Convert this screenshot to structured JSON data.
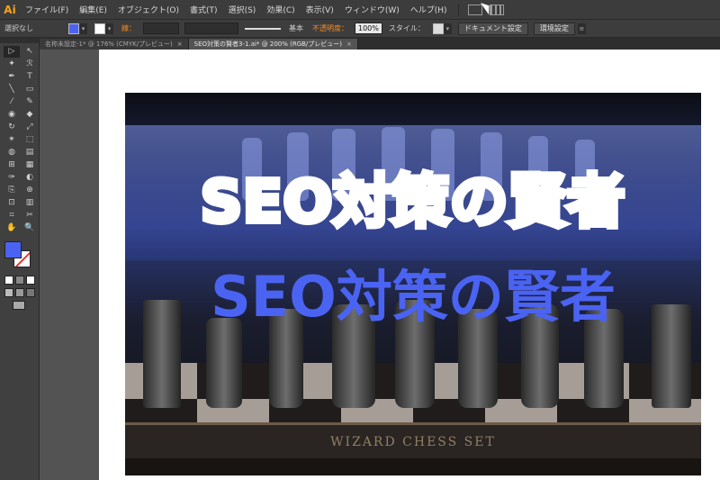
{
  "app": {
    "logo": "Ai"
  },
  "menu": [
    "ファイル(F)",
    "編集(E)",
    "オブジェクト(O)",
    "書式(T)",
    "選択(S)",
    "効果(C)",
    "表示(V)",
    "ウィンドウ(W)",
    "ヘルプ(H)"
  ],
  "control": {
    "selection_label": "選択なし",
    "stroke_label": "線：",
    "stroke_style": "基本",
    "opacity_label": "不透明度：",
    "opacity_value": "100%",
    "style_label": "スタイル：",
    "doc_settings": "ドキュメント設定",
    "preferences": "環境設定",
    "fill_color": "#4a63f2"
  },
  "tabs": [
    {
      "label": "名称未設定-1* @ 176% (CMYK/プレビュー)",
      "close": "×",
      "active": false
    },
    {
      "label": "SEO対策の賢者3-1.ai* @ 200% (RGB/プレビュー)",
      "close": "×",
      "active": true
    }
  ],
  "tools": [
    "▷",
    "↖",
    "✦",
    "ℛ",
    "✒",
    "T",
    "╲",
    "▭",
    "⁄",
    "✎",
    "◉",
    "◆",
    "↻",
    "⤢",
    "✴",
    "⬚",
    "◍",
    "▤",
    "⊞",
    "▦",
    "✑",
    "◐",
    "⎘",
    "⊕",
    "⊡",
    "▥",
    "⌗",
    "✂",
    "✋",
    "🔍"
  ],
  "artwork": {
    "title_white": "SEO対策の賢者",
    "title_blue": "SEO対策の賢者",
    "board_text": "WIZARD CHESS SET",
    "accent_blue": "#4a63f2"
  }
}
